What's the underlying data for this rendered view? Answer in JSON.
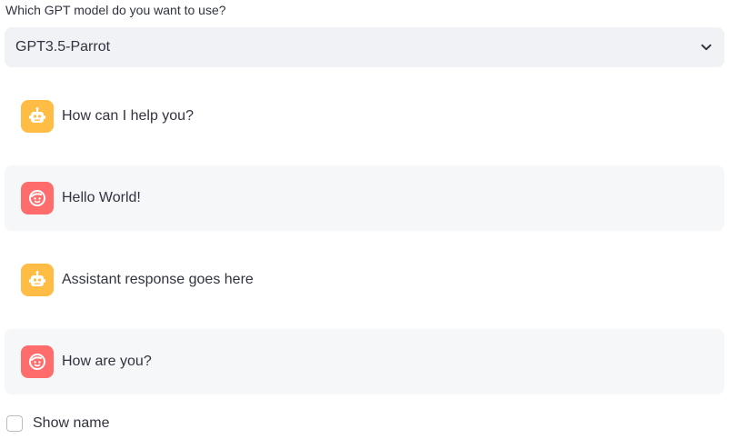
{
  "model_select": {
    "label": "Which GPT model do you want to use?",
    "value": "GPT3.5-Parrot",
    "icon": "chevron-down-icon"
  },
  "messages": [
    {
      "role": "assistant",
      "text": "How can I help you?",
      "avatar_icon": "bot-icon",
      "avatar_color": "#ffbd45"
    },
    {
      "role": "user",
      "text": "Hello World!",
      "avatar_icon": "face-icon",
      "avatar_color": "#ff6c6c"
    },
    {
      "role": "assistant",
      "text": "Assistant response goes here",
      "avatar_icon": "bot-icon",
      "avatar_color": "#ffbd45"
    },
    {
      "role": "user",
      "text": "How are you?",
      "avatar_icon": "face-icon",
      "avatar_color": "#ff6c6c"
    }
  ],
  "show_name": {
    "label": "Show name",
    "checked": false
  }
}
